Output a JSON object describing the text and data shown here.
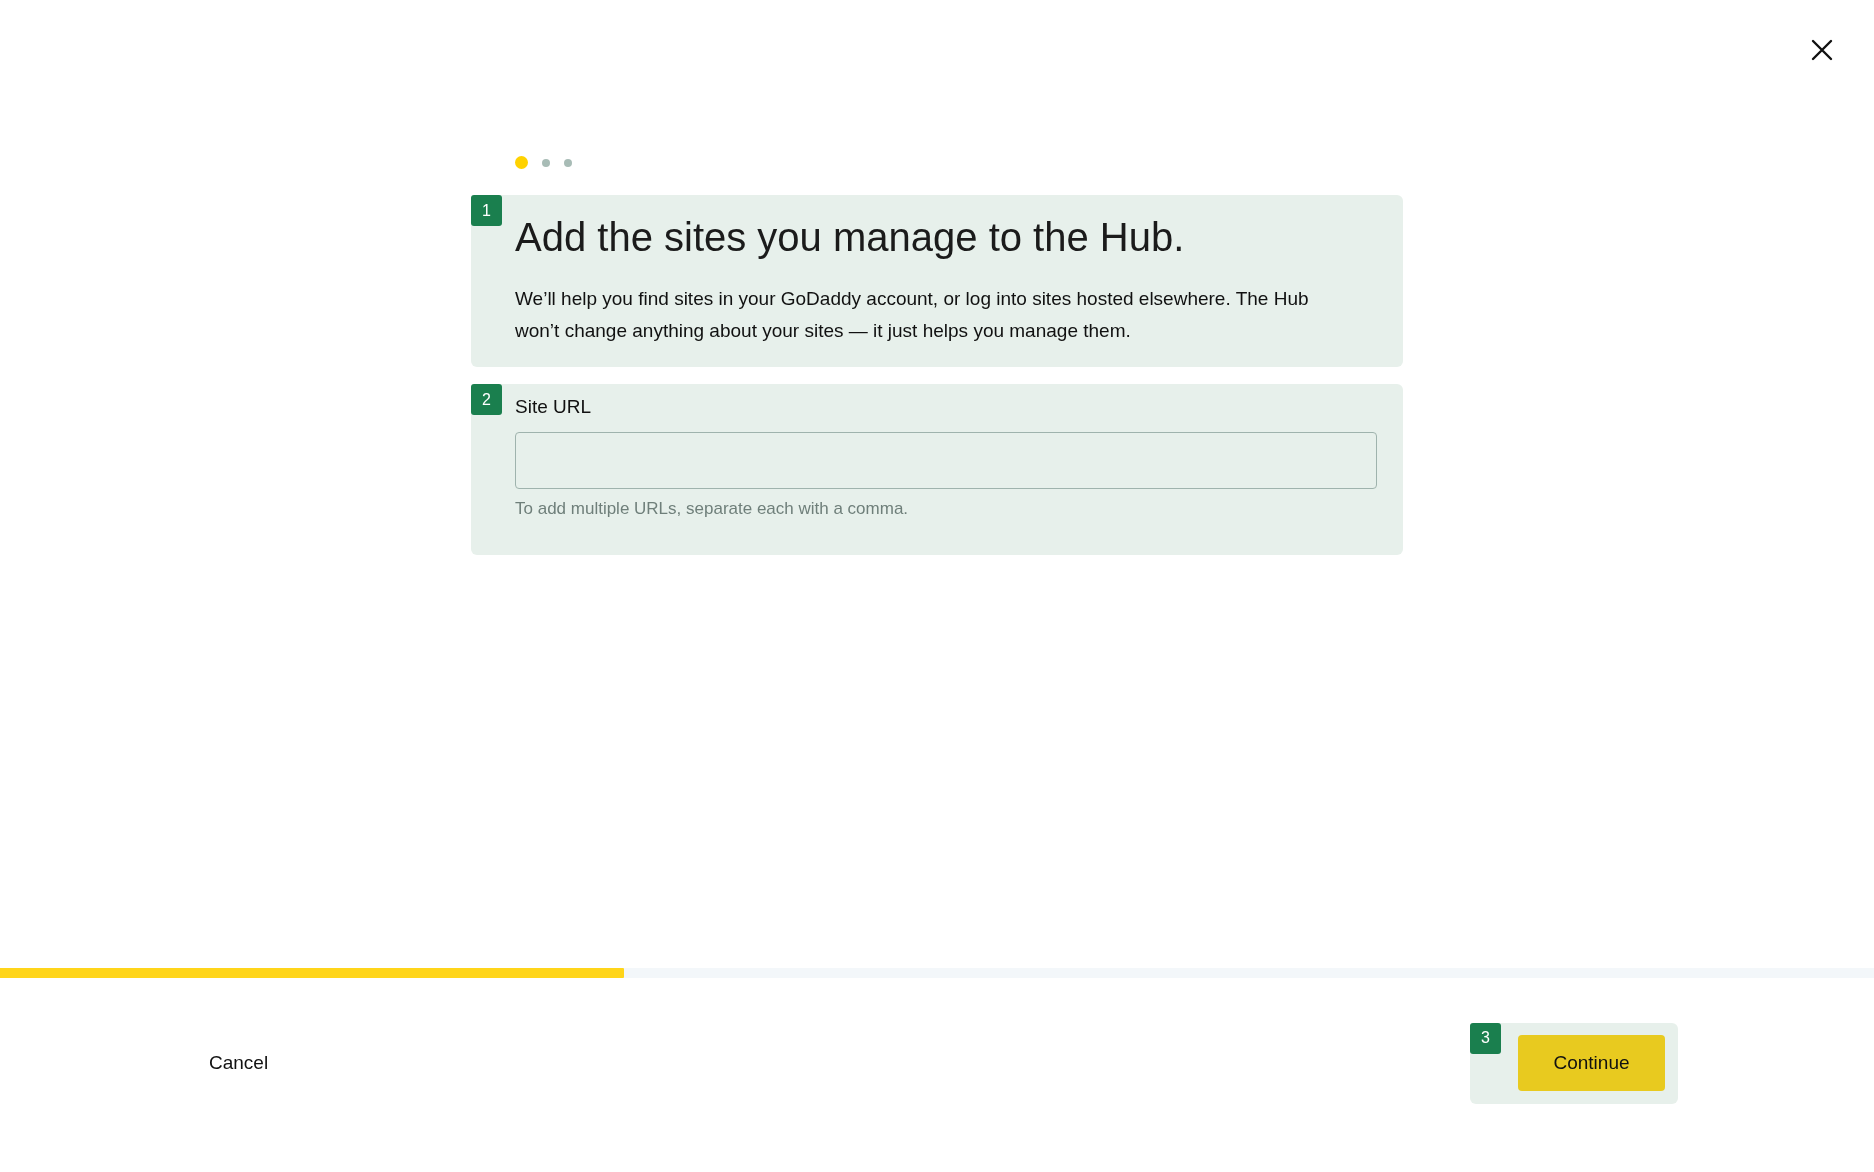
{
  "steps": [
    {
      "selected": true
    },
    {
      "selected": false
    },
    {
      "selected": false
    }
  ],
  "intro_card": {
    "badge": "1",
    "title": "Add the sites you manage to the Hub.",
    "body": "We’ll help you find sites in your GoDaddy account, or log into sites hosted elsewhere. The Hub won’t change anything about your sites — it just helps you manage them."
  },
  "url_card": {
    "badge": "2",
    "label": "Site URL",
    "hint": "To add multiple URLs, separate each with a comma."
  },
  "progress": {
    "level": 0.333
  },
  "footer": {
    "cancel": "Cancel",
    "continue_badge": "3",
    "continue": "Continue"
  }
}
